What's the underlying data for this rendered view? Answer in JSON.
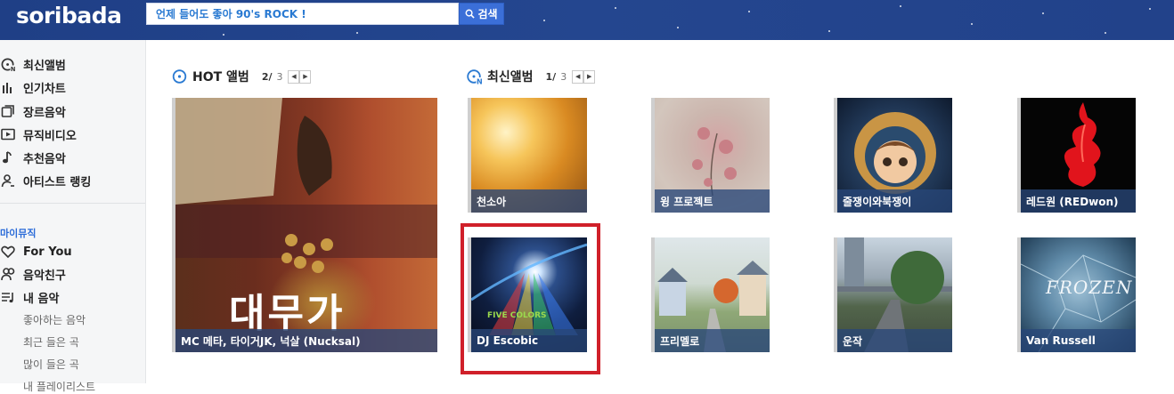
{
  "header": {
    "logo": "soribada",
    "search_value": "언제 들어도 좋아 90's ROCK !",
    "search_button": "검색"
  },
  "sidebar": {
    "items": [
      {
        "label": "최신앨범",
        "icon": "new-album-icon"
      },
      {
        "label": "인기차트",
        "icon": "chart-icon"
      },
      {
        "label": "장르음악",
        "icon": "genre-icon"
      },
      {
        "label": "뮤직비디오",
        "icon": "video-play-icon"
      },
      {
        "label": "추천음악",
        "icon": "music-note-icon"
      },
      {
        "label": "아티스트 랭킹",
        "icon": "artist-icon"
      }
    ],
    "my_music_title": "마이뮤직",
    "my_items": [
      {
        "label": "For You",
        "icon": "heart-icon"
      },
      {
        "label": "음악친구",
        "icon": "friends-icon"
      },
      {
        "label": "내 음악",
        "icon": "playlist-icon"
      }
    ],
    "sub_items": [
      "좋아하는 음악",
      "최근 들은 곡",
      "많이 들은 곡",
      "내 플레이리스트"
    ]
  },
  "hot": {
    "title": "HOT 앨범",
    "page_current": "2/",
    "page_total": "3",
    "album": {
      "caption": "MC 메타, 타이거JK, 넉살 (Nucksal)",
      "art_text": "대무가"
    }
  },
  "latest": {
    "title": "최신앨범",
    "page_current": "1/",
    "page_total": "3",
    "albums": [
      {
        "caption": "천소아"
      },
      {
        "caption": "윙 프로젝트"
      },
      {
        "caption": "줄쟁이와북쟁이"
      },
      {
        "caption": "레드원 (REDwon)"
      },
      {
        "caption": "DJ Escobic",
        "art_text": "FIVE COLORS"
      },
      {
        "caption": "프리멜로"
      },
      {
        "caption": "운작"
      },
      {
        "caption": "Van Russell",
        "art_text": "FROZEN"
      }
    ]
  },
  "colors": {
    "header_bg": "#22428a",
    "accent_blue": "#2a6bd8",
    "highlight_red": "#d0202a"
  }
}
